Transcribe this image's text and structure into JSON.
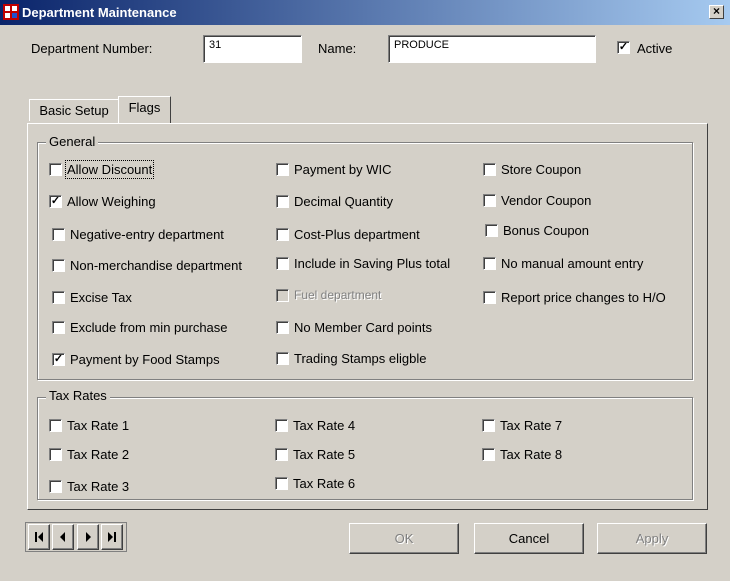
{
  "window": {
    "title": "Department Maintenance",
    "close_glyph": "×"
  },
  "header": {
    "dept_number_label": "Department Number:",
    "dept_number_value": "31",
    "name_label": "Name:",
    "name_value": "PRODUCE",
    "active_label": "Active",
    "active_checked": true
  },
  "tabs": [
    {
      "label": "Basic Setup",
      "selected": false
    },
    {
      "label": "Flags",
      "selected": true
    }
  ],
  "general": {
    "title": "General",
    "items": [
      {
        "label": "Allow Discount",
        "checked": false,
        "enabled": true
      },
      {
        "label": "Allow Weighing",
        "checked": true,
        "enabled": true
      },
      {
        "label": "Negative-entry department",
        "checked": false,
        "enabled": true
      },
      {
        "label": "Non-merchandise department",
        "checked": false,
        "enabled": true
      },
      {
        "label": "Excise Tax",
        "checked": false,
        "enabled": true
      },
      {
        "label": "Exclude from min purchase",
        "checked": false,
        "enabled": true
      },
      {
        "label": "Payment by Food Stamps",
        "checked": true,
        "enabled": true
      },
      {
        "label": "Payment by WIC",
        "checked": false,
        "enabled": true
      },
      {
        "label": "Decimal Quantity",
        "checked": false,
        "enabled": true
      },
      {
        "label": "Cost-Plus department",
        "checked": false,
        "enabled": true
      },
      {
        "label": "Include in Saving Plus total",
        "checked": false,
        "enabled": true
      },
      {
        "label": "Fuel department",
        "checked": false,
        "enabled": false
      },
      {
        "label": "No Member Card points",
        "checked": false,
        "enabled": true
      },
      {
        "label": "Trading Stamps eligble",
        "checked": false,
        "enabled": true
      },
      {
        "label": "Store Coupon",
        "checked": false,
        "enabled": true
      },
      {
        "label": "Vendor Coupon",
        "checked": false,
        "enabled": true
      },
      {
        "label": "Bonus Coupon",
        "checked": false,
        "enabled": true
      },
      {
        "label": "No manual amount entry",
        "checked": false,
        "enabled": true
      },
      {
        "label": "Report price changes to H/O",
        "checked": false,
        "enabled": true
      }
    ]
  },
  "tax_rates": {
    "title": "Tax Rates",
    "items": [
      {
        "label": "Tax Rate 1",
        "checked": false
      },
      {
        "label": "Tax Rate 2",
        "checked": false
      },
      {
        "label": "Tax Rate 3",
        "checked": false
      },
      {
        "label": "Tax Rate 4",
        "checked": false
      },
      {
        "label": "Tax Rate 5",
        "checked": false
      },
      {
        "label": "Tax Rate 6",
        "checked": false
      },
      {
        "label": "Tax Rate 7",
        "checked": false
      },
      {
        "label": "Tax Rate 8",
        "checked": false
      }
    ]
  },
  "buttons": {
    "ok": "OK",
    "cancel": "Cancel",
    "apply": "Apply",
    "ok_enabled": false,
    "apply_enabled": false
  },
  "nav": {
    "first_icon": "first-record-icon",
    "prev_icon": "previous-record-icon",
    "next_icon": "next-record-icon",
    "last_icon": "last-record-icon"
  },
  "colors": {
    "titlebar_start": "#0a246a",
    "titlebar_end": "#a6caf0",
    "face": "#d4d0c8"
  }
}
